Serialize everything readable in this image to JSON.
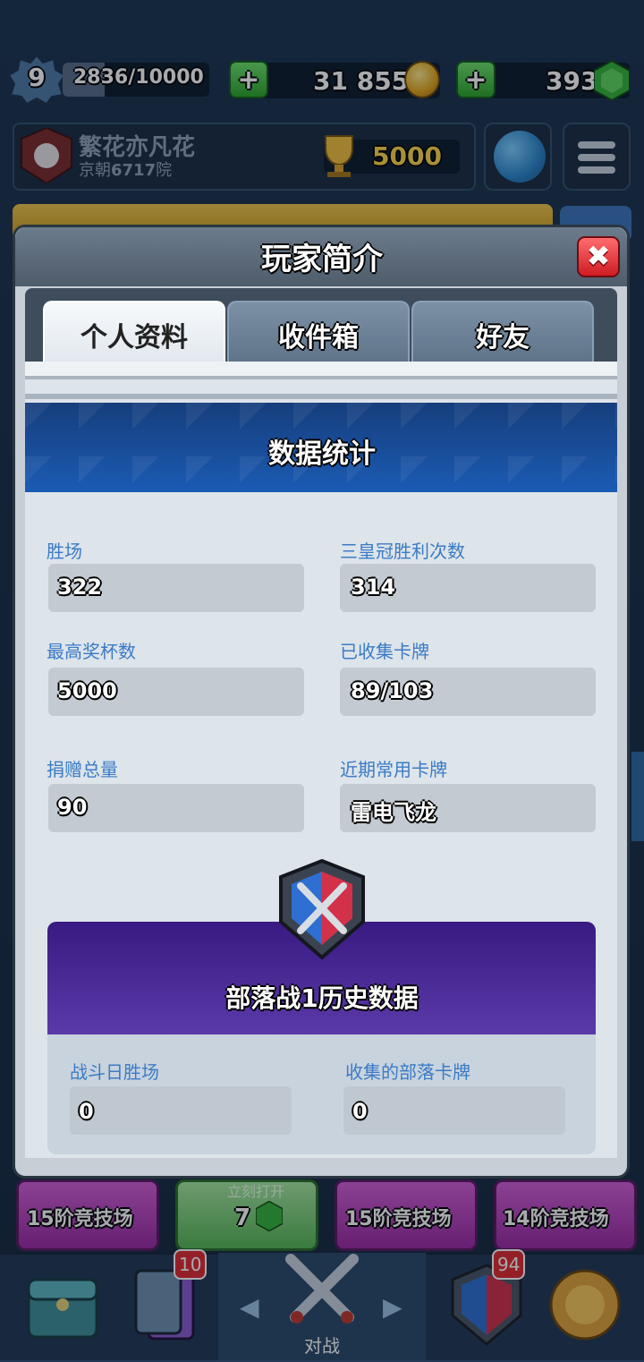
{
  "hud": {
    "level": "9",
    "xp_text": "2836/10000",
    "xp_progress": 0.2836,
    "gold": "31 855",
    "gems": "393"
  },
  "player": {
    "name": "繁花亦凡花",
    "clan_prefix": "京朝",
    "clan_number": "6717",
    "clan_suffix": "院",
    "trophies": "5000"
  },
  "modal": {
    "title": "玩家简介",
    "close": "✖",
    "tabs": [
      {
        "label": "个人资料",
        "active": true
      },
      {
        "label": "收件箱",
        "active": false
      },
      {
        "label": "好友",
        "active": false
      }
    ],
    "stats_title": "数据统计",
    "stats": [
      {
        "label": "胜场",
        "value": "322"
      },
      {
        "label": "三皇冠胜利次数",
        "value": "314"
      },
      {
        "label": "最高奖杯数",
        "value": "5000"
      },
      {
        "label": "已收集卡牌",
        "value": "89/103"
      },
      {
        "label": "捐赠总量",
        "value": "90"
      },
      {
        "label": "近期常用卡牌",
        "value": "雷电飞龙"
      }
    ],
    "clan_war": {
      "title": "部落战1历史数据",
      "fields": [
        {
          "label": "战斗日胜场",
          "value": "0"
        },
        {
          "label": "收集的部落卡牌",
          "value": "0"
        }
      ]
    }
  },
  "chests": [
    {
      "label": "15阶竞技场"
    },
    {
      "label": "立刻打开",
      "cost": "7"
    },
    {
      "label": "15阶竞技场"
    },
    {
      "label": "14阶竞技场"
    }
  ],
  "nav": {
    "cards_badge": "10",
    "clan_badge": "94",
    "battle_label": "对战"
  },
  "colors": {
    "accent_blue": "#3b7bc6",
    "close_red": "#e12b31",
    "war_purple": "#391a82",
    "gold_text": "#ffd84a"
  }
}
